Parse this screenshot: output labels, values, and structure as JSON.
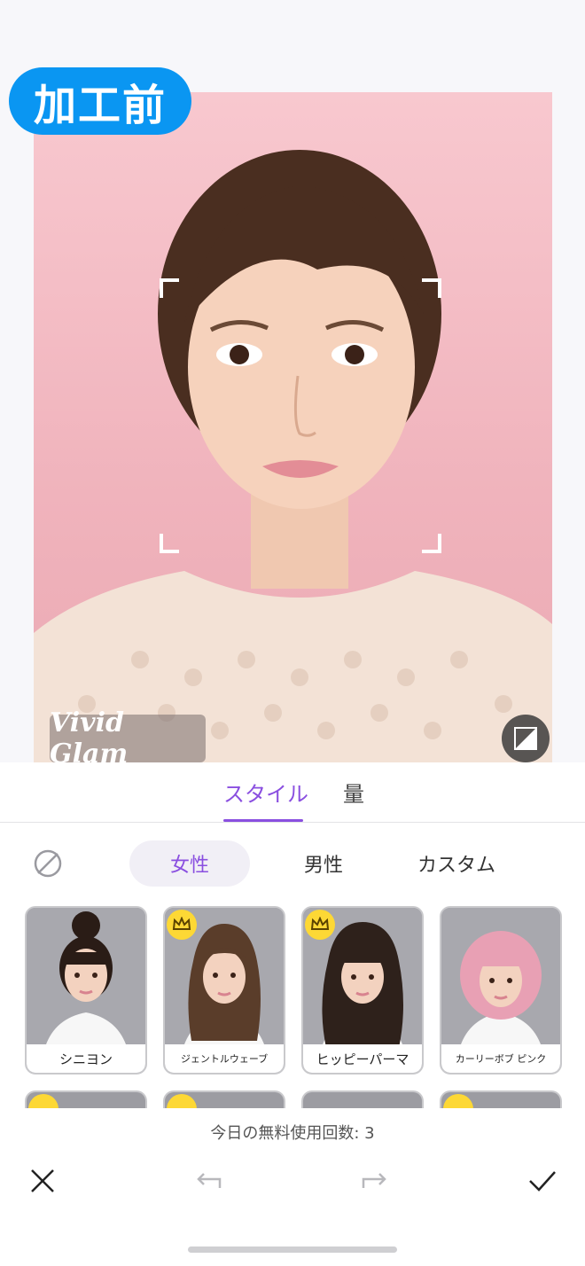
{
  "preview": {
    "before_label": "加工前",
    "watermark": "Vivid Glam"
  },
  "tabs": [
    {
      "label": "スタイル",
      "active": true
    },
    {
      "label": "量",
      "active": false
    }
  ],
  "segments": [
    {
      "label": "女性",
      "active": true
    },
    {
      "label": "男性",
      "active": false
    },
    {
      "label": "カスタム",
      "active": false
    }
  ],
  "styles": [
    {
      "label": "シニヨン",
      "premium": false,
      "hair_color": "#2a1c16"
    },
    {
      "label": "ジェントルウェーブ",
      "premium": true,
      "hair_color": "#5a3d2a"
    },
    {
      "label": "ヒッピーパーマ",
      "premium": true,
      "hair_color": "#2e211b"
    },
    {
      "label": "カーリーボブ ピンク",
      "premium": false,
      "hair_color": "#e8a0b4"
    }
  ],
  "footer": {
    "free_count": "今日の無料使用回数: 3"
  },
  "colors": {
    "accent": "#8a4fe0",
    "badge": "#0a96f2",
    "crown": "#fdd835"
  }
}
